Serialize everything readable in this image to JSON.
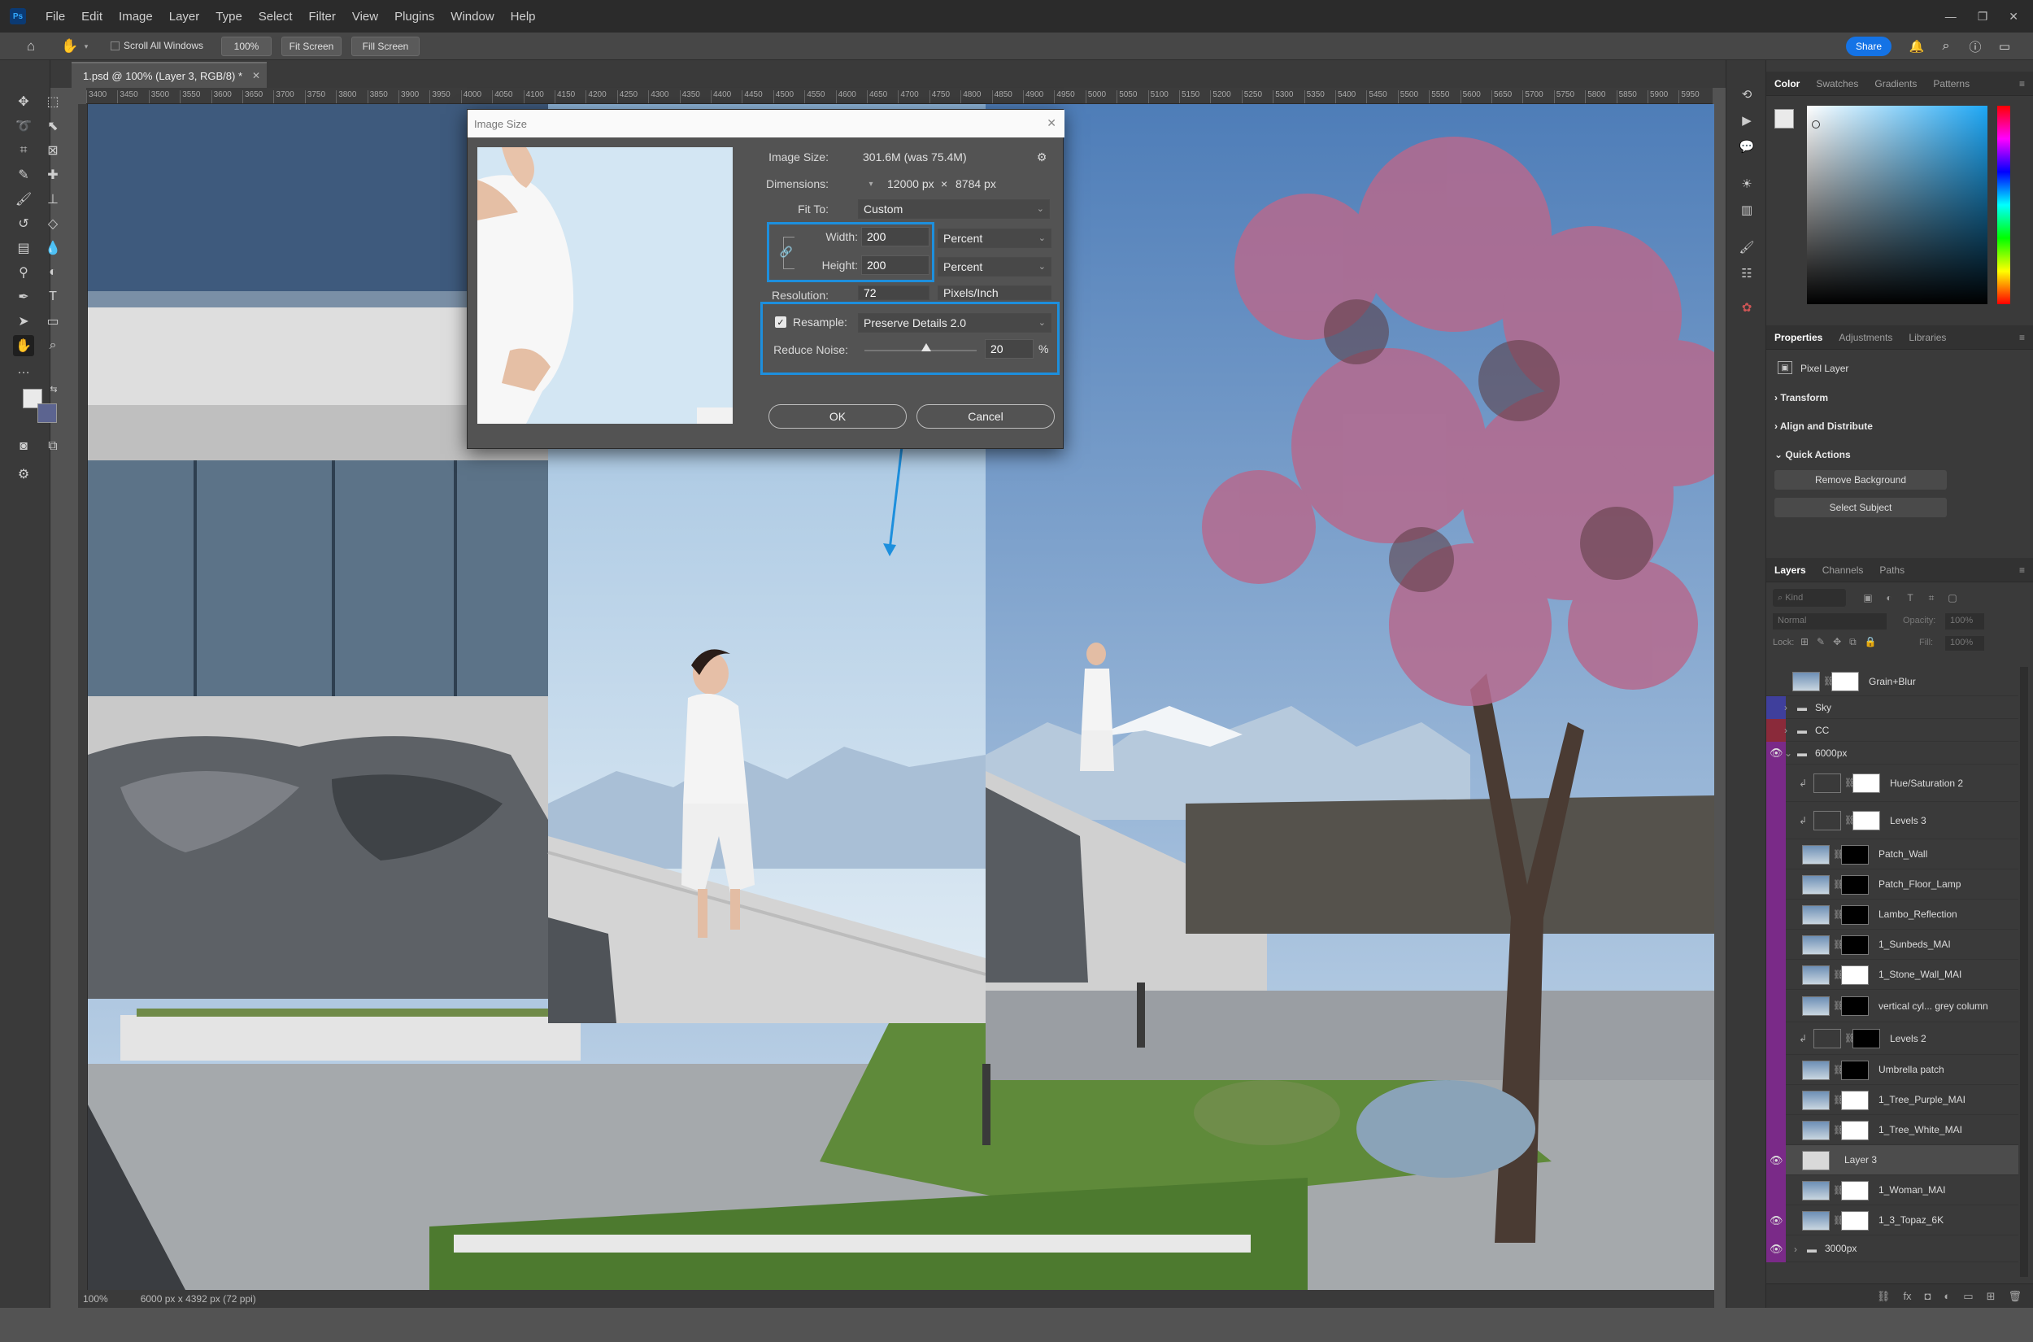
{
  "app": {
    "logo_text": "Ps"
  },
  "menubar": {
    "items": [
      "File",
      "Edit",
      "Image",
      "Layer",
      "Type",
      "Select",
      "Filter",
      "View",
      "Plugins",
      "Window",
      "Help"
    ]
  },
  "topbar": {
    "share_label": "Share"
  },
  "options": {
    "scroll_all_windows": "Scroll All Windows",
    "zoom": "100%",
    "fit_screen": "Fit Screen",
    "fill_screen": "Fill Screen"
  },
  "document": {
    "tab_title": "1.psd @ 100% (Layer 3, RGB/8) *"
  },
  "ruler": {
    "ticks": [
      "3400",
      "3450",
      "3500",
      "3550",
      "3600",
      "3650",
      "3700",
      "3750",
      "3800",
      "3850",
      "3900",
      "3950",
      "4000",
      "4050",
      "4100",
      "4150",
      "4200",
      "4250",
      "4300",
      "4350",
      "4400",
      "4450",
      "4500",
      "4550",
      "4600",
      "4650",
      "4700",
      "4750",
      "4800",
      "4850",
      "4900",
      "4950",
      "5000",
      "5050",
      "5100",
      "5150",
      "5200",
      "5250",
      "5300",
      "5350",
      "5400",
      "5450",
      "5500",
      "5550",
      "5600",
      "5650",
      "5700",
      "5750",
      "5800",
      "5850",
      "5900",
      "5950"
    ]
  },
  "status": {
    "zoom": "100%",
    "doc_info": "6000 px x 4392 px (72 ppi)"
  },
  "dialog": {
    "title": "Image Size",
    "image_size_label": "Image Size:",
    "image_size_value": "301.6M (was 75.4M)",
    "dimensions_label": "Dimensions:",
    "dim_w": "12000 px",
    "dim_x": "×",
    "dim_h": "8784 px",
    "fit_to_label": "Fit To:",
    "fit_to_value": "Custom",
    "width_label": "Width:",
    "width_value": "200",
    "width_unit": "Percent",
    "height_label": "Height:",
    "height_value": "200",
    "height_unit": "Percent",
    "resolution_label": "Resolution:",
    "resolution_value": "72",
    "resolution_unit": "Pixels/Inch",
    "resample_label": "Resample:",
    "resample_value": "Preserve Details 2.0",
    "reduce_noise_label": "Reduce Noise:",
    "reduce_noise_value": "20",
    "reduce_noise_unit": "%",
    "reduce_noise_level": 0.2,
    "ok_label": "OK",
    "cancel_label": "Cancel"
  },
  "color_panel": {
    "tabs": [
      "Color",
      "Swatches",
      "Gradients",
      "Patterns"
    ]
  },
  "properties_panel": {
    "tabs": [
      "Properties",
      "Adjustments",
      "Libraries"
    ],
    "layer_kind": "Pixel Layer",
    "transform": "Transform",
    "align": "Align and Distribute",
    "quick_actions": "Quick Actions",
    "remove_bg": "Remove Background",
    "select_subject": "Select Subject"
  },
  "layers_panel": {
    "tabs": [
      "Layers",
      "Channels",
      "Paths"
    ],
    "filter_placeholder": "Kind",
    "blend_mode": "Normal",
    "opacity_label": "Opacity:",
    "opacity_value": "100%",
    "lock_label": "Lock:",
    "fill_label": "Fill:",
    "fill_value": "100%",
    "layers": [
      {
        "name": "Grain+Blur",
        "color": "",
        "visible": false
      },
      {
        "name": "Sky",
        "color": "#3f3f9c",
        "visible": false
      },
      {
        "name": "CC",
        "color": "#8a2a3a",
        "visible": false
      },
      {
        "name": "6000px",
        "color": "#7a2a88",
        "visible": true
      },
      {
        "name": "Hue/Saturation 2",
        "color": "#7a2a88",
        "visible": false
      },
      {
        "name": "Levels 3",
        "color": "#7a2a88",
        "visible": false
      },
      {
        "name": "Patch_Wall",
        "color": "#7a2a88",
        "visible": false
      },
      {
        "name": "Patch_Floor_Lamp",
        "color": "#7a2a88",
        "visible": false
      },
      {
        "name": "Lambo_Reflection",
        "color": "#7a2a88",
        "visible": false
      },
      {
        "name": "1_Sunbeds_MAI",
        "color": "#7a2a88",
        "visible": false
      },
      {
        "name": "1_Stone_Wall_MAI",
        "color": "#7a2a88",
        "visible": false
      },
      {
        "name": "vertical cyl... grey column",
        "color": "#7a2a88",
        "visible": false
      },
      {
        "name": "Levels 2",
        "color": "#7a2a88",
        "visible": false
      },
      {
        "name": "Umbrella patch",
        "color": "#7a2a88",
        "visible": false
      },
      {
        "name": "1_Tree_Purple_MAI",
        "color": "#7a2a88",
        "visible": false
      },
      {
        "name": "1_Tree_White_MAI",
        "color": "#7a2a88",
        "visible": false
      },
      {
        "name": "Layer 3",
        "color": "#7a2a88",
        "visible": true
      },
      {
        "name": "1_Woman_MAI",
        "color": "#7a2a88",
        "visible": false
      },
      {
        "name": "1_3_Topaz_6K",
        "color": "#7a2a88",
        "visible": true
      },
      {
        "name": "3000px",
        "color": "#7a2a88",
        "visible": true
      }
    ]
  },
  "colors": {
    "accent": "#1d8fdd",
    "share": "#1473e6",
    "group_purple": "#7a2a88"
  }
}
